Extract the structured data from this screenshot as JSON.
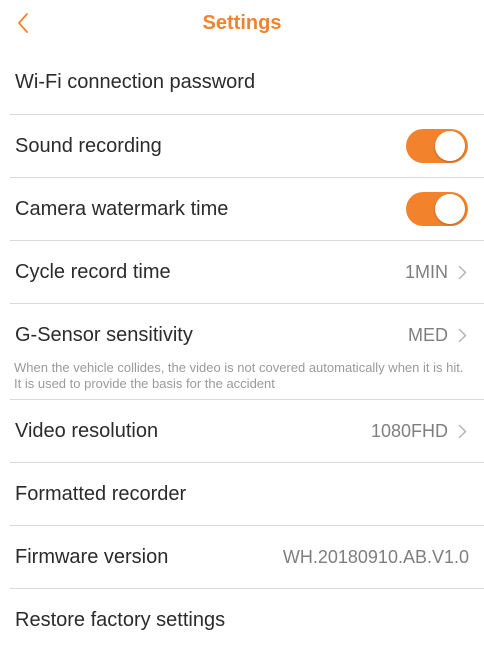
{
  "header": {
    "back_icon": "chevron-left-icon",
    "title": "Settings"
  },
  "settings": {
    "wifi_password": {
      "label": "Wi-Fi connection password"
    },
    "sound_recording": {
      "label": "Sound recording",
      "enabled": true
    },
    "watermark_time": {
      "label": "Camera watermark time",
      "enabled": true
    },
    "cycle_record": {
      "label": "Cycle record time",
      "value": "1MIN"
    },
    "gsensor": {
      "label": "G-Sensor sensitivity",
      "value": "MED",
      "hint": "When the vehicle collides, the video is not covered automatically when it is hit. It is used to provide the basis for the accident"
    },
    "video_resolution": {
      "label": "Video resolution",
      "value": "1080FHD"
    },
    "format_recorder": {
      "label": "Formatted recorder"
    },
    "firmware": {
      "label": "Firmware version",
      "value": "WH.20180910.AB.V1.0"
    },
    "restore_factory": {
      "label": "Restore factory settings"
    }
  },
  "colors": {
    "accent": "#f2832c",
    "divider": "#d9d9d9",
    "value_text": "#7f7f7f",
    "hint_text": "#9a9a9a"
  }
}
